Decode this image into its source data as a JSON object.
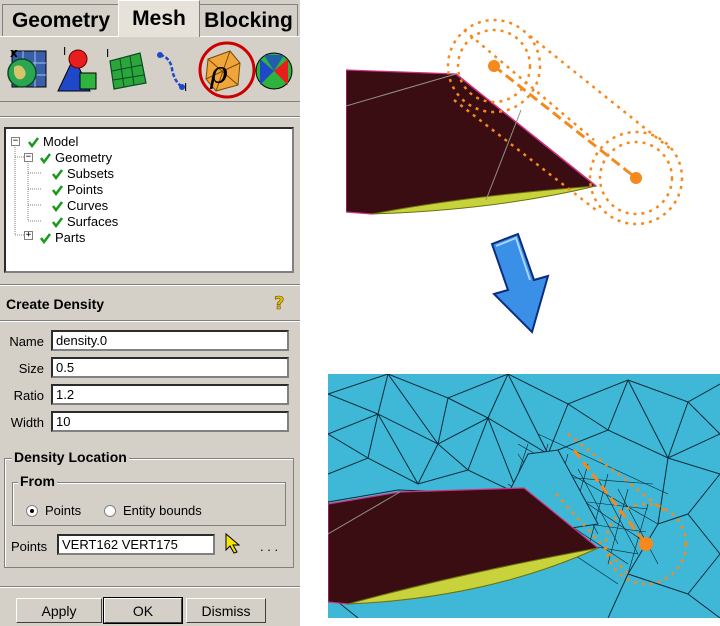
{
  "tabs": [
    {
      "label": "Geometry"
    },
    {
      "label": "Mesh"
    },
    {
      "label": "Blocking"
    }
  ],
  "toolbar": {
    "icons": [
      "global-mesh-setup-icon",
      "part-mesh-setup-icon",
      "surface-mesh-setup-icon",
      "curve-mesh-setup-icon",
      "create-density-icon",
      "build-topology-icon"
    ],
    "highlight_color": "#cc0000"
  },
  "tree": {
    "root": "Model",
    "geometry": "Geometry",
    "items": [
      "Subsets",
      "Points",
      "Curves",
      "Surfaces"
    ],
    "parts": "Parts"
  },
  "form": {
    "title": "Create Density",
    "help_icon": "help-question-icon",
    "fields": {
      "name": {
        "label": "Name",
        "value": "density.0"
      },
      "size": {
        "label": "Size",
        "value": "0.5"
      },
      "ratio": {
        "label": "Ratio",
        "value": "1.2"
      },
      "width": {
        "label": "Width",
        "value": "10"
      }
    },
    "location_group": "Density Location",
    "from_group": "From",
    "radio_points": "Points",
    "radio_entity": "Entity bounds",
    "points_label": "Points",
    "points_value": "VERT162 VERT175",
    "ellipsis": ". . ."
  },
  "buttons": {
    "apply": "Apply",
    "ok": "OK",
    "dismiss": "Dismiss"
  },
  "colors": {
    "panel": "#d4d0c8",
    "wing_dark": "#3a0d12",
    "wing_edge": "#c8d23a",
    "density_orange": "#f5891e",
    "mesh_bg": "#3fb8d8",
    "arrow_blue": "#3a8fe6"
  }
}
